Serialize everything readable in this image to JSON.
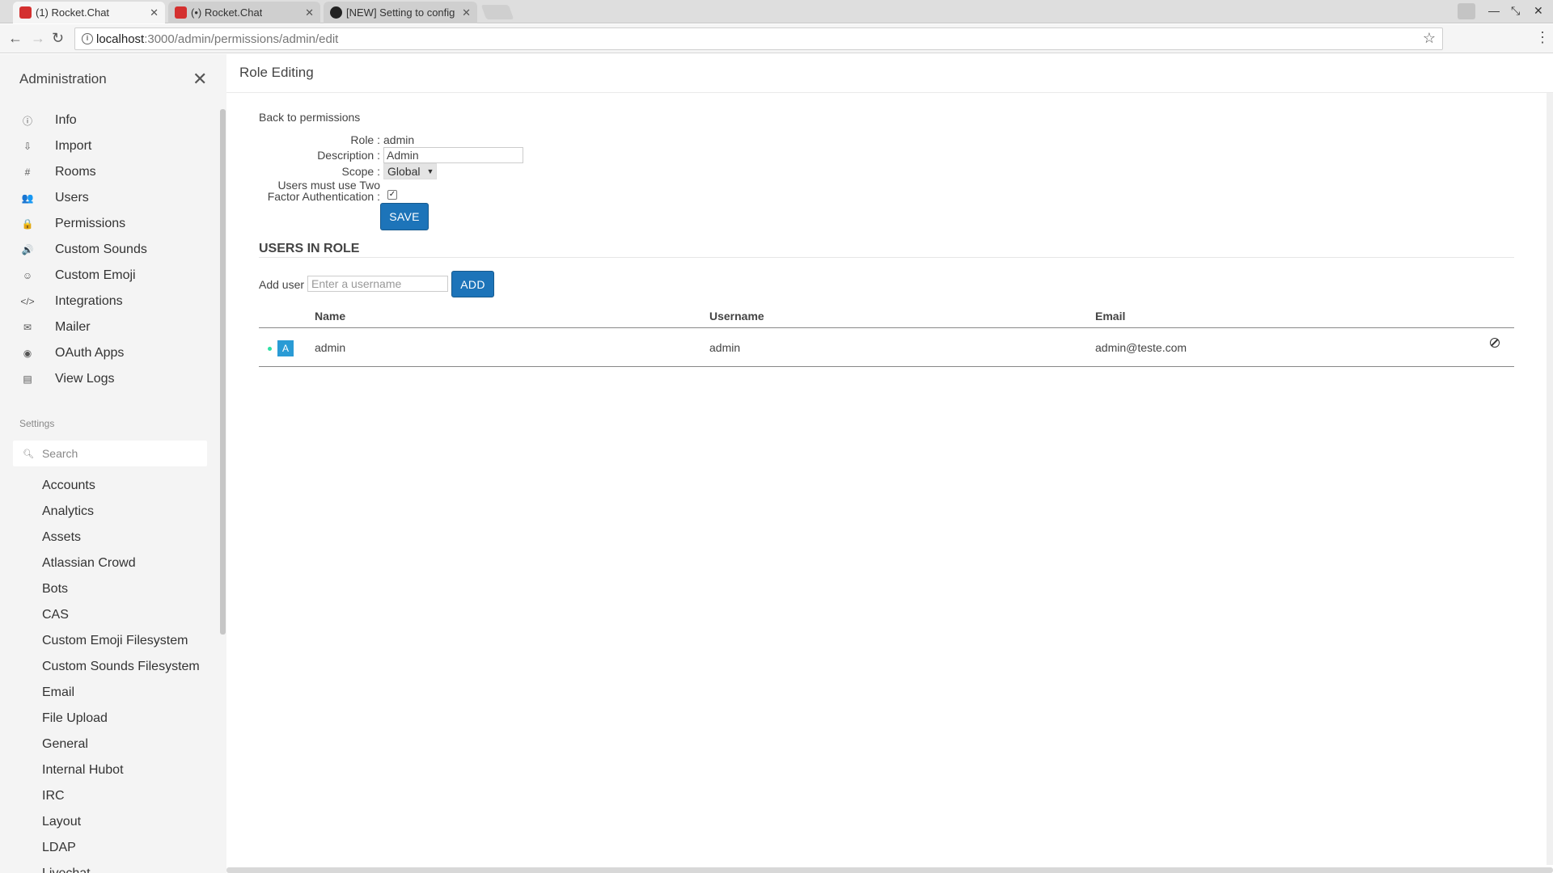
{
  "browser": {
    "tabs": [
      {
        "title": "(1) Rocket.Chat",
        "active": true
      },
      {
        "title": "(•) Rocket.Chat",
        "active": false
      },
      {
        "title": "[NEW] Setting to config",
        "active": false
      }
    ],
    "url_host": "localhost",
    "url_path": ":3000/admin/permissions/admin/edit"
  },
  "sidebar": {
    "title": "Administration",
    "nav": [
      {
        "label": "Info",
        "icon": "info-icon",
        "glyph": "ⓘ"
      },
      {
        "label": "Import",
        "icon": "import-icon",
        "glyph": "⇩"
      },
      {
        "label": "Rooms",
        "icon": "hashtag-icon",
        "glyph": "#"
      },
      {
        "label": "Users",
        "icon": "team-icon",
        "glyph": "👥"
      },
      {
        "label": "Permissions",
        "icon": "lock-icon",
        "glyph": "🔒"
      },
      {
        "label": "Custom Sounds",
        "icon": "volume-icon",
        "glyph": "🔊"
      },
      {
        "label": "Custom Emoji",
        "icon": "emoji-icon",
        "glyph": "☺"
      },
      {
        "label": "Integrations",
        "icon": "code-icon",
        "glyph": "</>"
      },
      {
        "label": "Mailer",
        "icon": "mail-icon",
        "glyph": "✉"
      },
      {
        "label": "OAuth Apps",
        "icon": "oauth-icon",
        "glyph": "◉"
      },
      {
        "label": "View Logs",
        "icon": "file-icon",
        "glyph": "▤"
      }
    ],
    "settings_heading": "Settings",
    "search_placeholder": "Search",
    "settings": [
      "Accounts",
      "Analytics",
      "Assets",
      "Atlassian Crowd",
      "Bots",
      "CAS",
      "Custom Emoji Filesystem",
      "Custom Sounds Filesystem",
      "Email",
      "File Upload",
      "General",
      "Internal Hubot",
      "IRC",
      "Layout",
      "LDAP",
      "Livechat"
    ]
  },
  "main": {
    "title": "Role Editing",
    "back_link": "Back to permissions",
    "form": {
      "role_label": "Role :",
      "role_value": "admin",
      "description_label": "Description :",
      "description_value": "Admin",
      "scope_label": "Scope :",
      "scope_value": "Global",
      "twofa_label_line1": "Users must use Two",
      "twofa_label_line2": "Factor Authentication :",
      "twofa_checked": true,
      "save_label": "SAVE"
    },
    "users_in_role": {
      "heading": "USERS IN ROLE",
      "add_user_label": "Add user",
      "add_user_placeholder": "Enter a username",
      "add_button": "ADD",
      "columns": [
        "Name",
        "Username",
        "Email"
      ],
      "rows": [
        {
          "avatar_letter": "A",
          "name": "admin",
          "username": "admin",
          "email": "admin@teste.com",
          "status_color": "#2de0a5"
        }
      ]
    }
  },
  "colors": {
    "primary_button": "#1d74b9",
    "sidebar_bg": "#f4f4f4",
    "avatar": "#2a9bd5",
    "online_status": "#2de0a5"
  }
}
